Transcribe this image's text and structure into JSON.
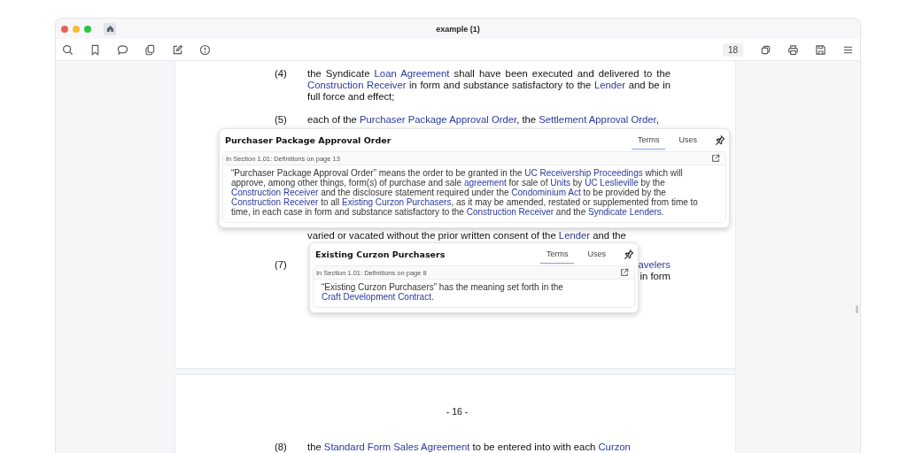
{
  "window": {
    "title": "example (1)"
  },
  "toolbar": {
    "page_number": "18"
  },
  "pages": [
    {
      "paragraphs": [
        {
          "kind": "item",
          "number": "(4)",
          "segments": [
            {
              "text": "the Syndicate ",
              "kind": "text"
            },
            {
              "text": "Loan Agreement",
              "kind": "link"
            },
            {
              "text": " shall have been executed and delivered to the ",
              "kind": "text"
            },
            {
              "text": "Construction Receiver",
              "kind": "link"
            },
            {
              "text": " in form and substance satisfactory to the ",
              "kind": "text"
            },
            {
              "text": "Lender",
              "kind": "link"
            },
            {
              "text": " and be in full force and effect;",
              "kind": "text"
            }
          ]
        },
        {
          "kind": "item",
          "number": "(5)",
          "segments": [
            {
              "text": "each of the ",
              "kind": "text"
            },
            {
              "text": "Purchaser Package Approval Order",
              "kind": "link"
            },
            {
              "text": ", the ",
              "kind": "text"
            },
            {
              "text": "Settlement Approval Order",
              "kind": "link"
            },
            {
              "text": ",",
              "kind": "text"
            }
          ]
        },
        {
          "kind": "continuation",
          "segments": [
            {
              "text": "varied or vacated without the prior written consent of the ",
              "kind": "text"
            },
            {
              "text": "Lender",
              "kind": "link"
            },
            {
              "text": " and the",
              "kind": "text"
            }
          ]
        },
        {
          "kind": "fragments",
          "number": "(7)",
          "right_lines": [
            {
              "text": "avelers",
              "kind": "link"
            },
            {
              "text": "in form",
              "kind": "text"
            }
          ]
        }
      ]
    },
    {
      "page_label": "- 16 -",
      "paragraphs": [
        {
          "kind": "item",
          "number": "(8)",
          "segments": [
            {
              "text": "the ",
              "kind": "text"
            },
            {
              "text": "Standard Form Sales Agreement",
              "kind": "link"
            },
            {
              "text": " to be entered into with each ",
              "kind": "text"
            },
            {
              "text": "Curzon",
              "kind": "link"
            }
          ]
        }
      ]
    }
  ],
  "popups": [
    {
      "title": "Purchaser Package Approval Order",
      "tabs": [
        {
          "label": "Terms",
          "selected": true
        },
        {
          "label": "Uses",
          "selected": false
        }
      ],
      "source": "In Section 1.01: Definitions on page 13",
      "segments": [
        {
          "text": "“Purchaser Package Approval Order” means the order to be granted in the ",
          "kind": "text"
        },
        {
          "text": "UC Receivership Proceedings",
          "kind": "link"
        },
        {
          "text": " which will approve, among other things, form(s) of purchase and sale ",
          "kind": "text"
        },
        {
          "text": "agreement",
          "kind": "link"
        },
        {
          "text": " for sale of ",
          "kind": "text"
        },
        {
          "text": "Units",
          "kind": "link"
        },
        {
          "text": " by ",
          "kind": "text"
        },
        {
          "text": "UC Leslieville",
          "kind": "link"
        },
        {
          "text": " by the ",
          "kind": "text"
        },
        {
          "text": "Construction Receiver",
          "kind": "link"
        },
        {
          "text": " and the disclosure statement required under the ",
          "kind": "text"
        },
        {
          "text": "Condominium Act",
          "kind": "link"
        },
        {
          "text": " to be provided by the ",
          "kind": "text"
        },
        {
          "text": "Construction Receiver",
          "kind": "link"
        },
        {
          "text": " to all ",
          "kind": "text"
        },
        {
          "text": "Existing Curzon Purchasers",
          "kind": "link"
        },
        {
          "text": ", as it may be amended, restated or supplemented from time to time, in each case in form and substance satisfactory to the ",
          "kind": "text"
        },
        {
          "text": "Construction Receiver",
          "kind": "link"
        },
        {
          "text": " and the ",
          "kind": "text"
        },
        {
          "text": "Syndicate Lenders",
          "kind": "link"
        },
        {
          "text": ".",
          "kind": "text"
        }
      ]
    },
    {
      "title": "Existing Curzon Purchasers",
      "tabs": [
        {
          "label": "Terms",
          "selected": true
        },
        {
          "label": "Uses",
          "selected": false
        }
      ],
      "source": "In Section 1.01: Definitions on page 8",
      "segments": [
        {
          "text": "“Existing Curzon Purchasers” has the meaning set forth in the ",
          "kind": "text"
        },
        {
          "text": "Craft Development Contract",
          "kind": "link"
        },
        {
          "text": ".",
          "kind": "text"
        }
      ]
    }
  ]
}
